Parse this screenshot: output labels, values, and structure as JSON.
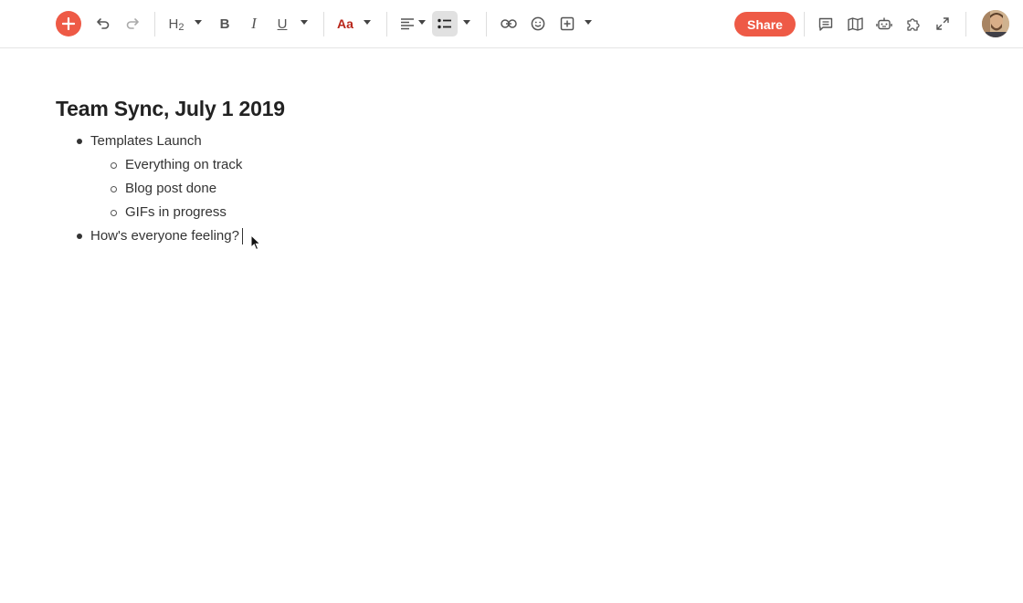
{
  "toolbar": {
    "buttons": {
      "add": "plus-icon",
      "undo": "undo-icon",
      "redo": "redo-icon",
      "heading": "heading-icon",
      "bold": "bold-icon",
      "italic": "italic-icon",
      "underline": "underline-icon",
      "text_style": "text-color-icon",
      "align": "align-left-icon",
      "list": "bulleted-list-icon",
      "link": "link-icon",
      "emoji": "emoji-icon",
      "insert": "insert-icon",
      "comments": "comment-icon",
      "map": "map-icon",
      "robot": "robot-icon",
      "plugins": "puzzle-icon",
      "fullscreen": "expand-icon"
    },
    "heading_label_main": "H",
    "heading_label_sub": "2",
    "bold_label": "B",
    "italic_label": "I",
    "underline_label": "U",
    "text_style_label": "Aa",
    "share_label": "Share"
  },
  "colors": {
    "accent": "#ee5a46",
    "text_style": "#b8261a",
    "active_bg": "#e1e1e1"
  },
  "document": {
    "title": "Team Sync, July 1 2019",
    "items": [
      {
        "text": "Templates Launch",
        "children": [
          {
            "text": "Everything on track"
          },
          {
            "text": "Blog post done"
          },
          {
            "text": "GIFs in progress"
          }
        ]
      },
      {
        "text": "How's everyone feeling?"
      }
    ]
  }
}
